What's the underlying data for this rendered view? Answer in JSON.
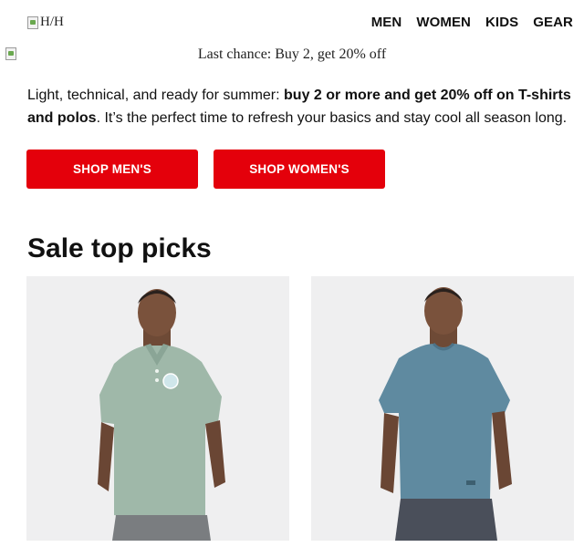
{
  "header": {
    "logo_alt": "H/H",
    "nav": [
      "MEN",
      "WOMEN",
      "KIDS",
      "GEAR"
    ]
  },
  "promo": {
    "text": "Last chance: Buy 2, get 20% off"
  },
  "intro": {
    "lead": "Light, technical, and ready for summer: ",
    "bold": "buy 2 or more and get 20% off on T-shirts and polos",
    "tail": ". It’s the perfect time to refresh your basics and stay cool all season long."
  },
  "buttons": {
    "men": "SHOP MEN'S",
    "women": "SHOP WOMEN'S"
  },
  "section": {
    "title": "Sale top picks"
  },
  "products": [
    {
      "icon": "polo-shirt-image",
      "shirt_color": "#9fb8a9",
      "shorts_color": "#7a7d80"
    },
    {
      "icon": "tshirt-image",
      "shirt_color": "#5f8aa0",
      "shorts_color": "#4a4f5a"
    }
  ],
  "colors": {
    "accent": "#e4000b",
    "card_bg": "#efeff0"
  }
}
